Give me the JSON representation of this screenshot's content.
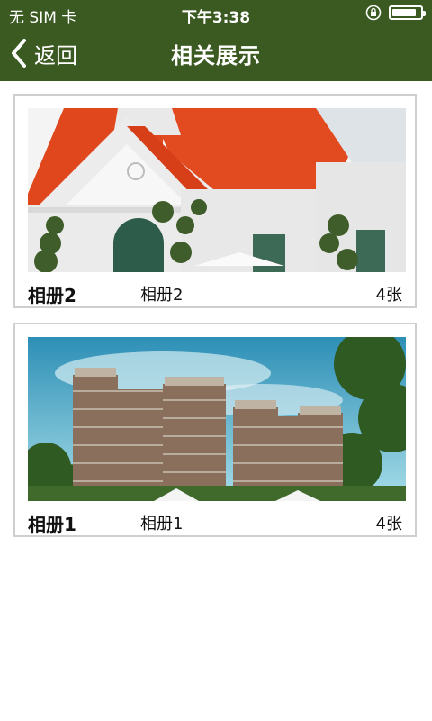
{
  "status_bar": {
    "carrier": "无 SIM 卡",
    "time": "下午3:38",
    "battery_level": 0.85
  },
  "nav": {
    "back_label": "返回",
    "title": "相关展示"
  },
  "albums": [
    {
      "name": "相册2",
      "subtitle": "相册2",
      "count": "4张",
      "image": "white-house-red-roof"
    },
    {
      "name": "相册1",
      "subtitle": "相册1",
      "count": "4张",
      "image": "apartment-towers"
    }
  ],
  "colors": {
    "nav_background": "#3b5a22",
    "card_border": "#cfcfcf"
  }
}
